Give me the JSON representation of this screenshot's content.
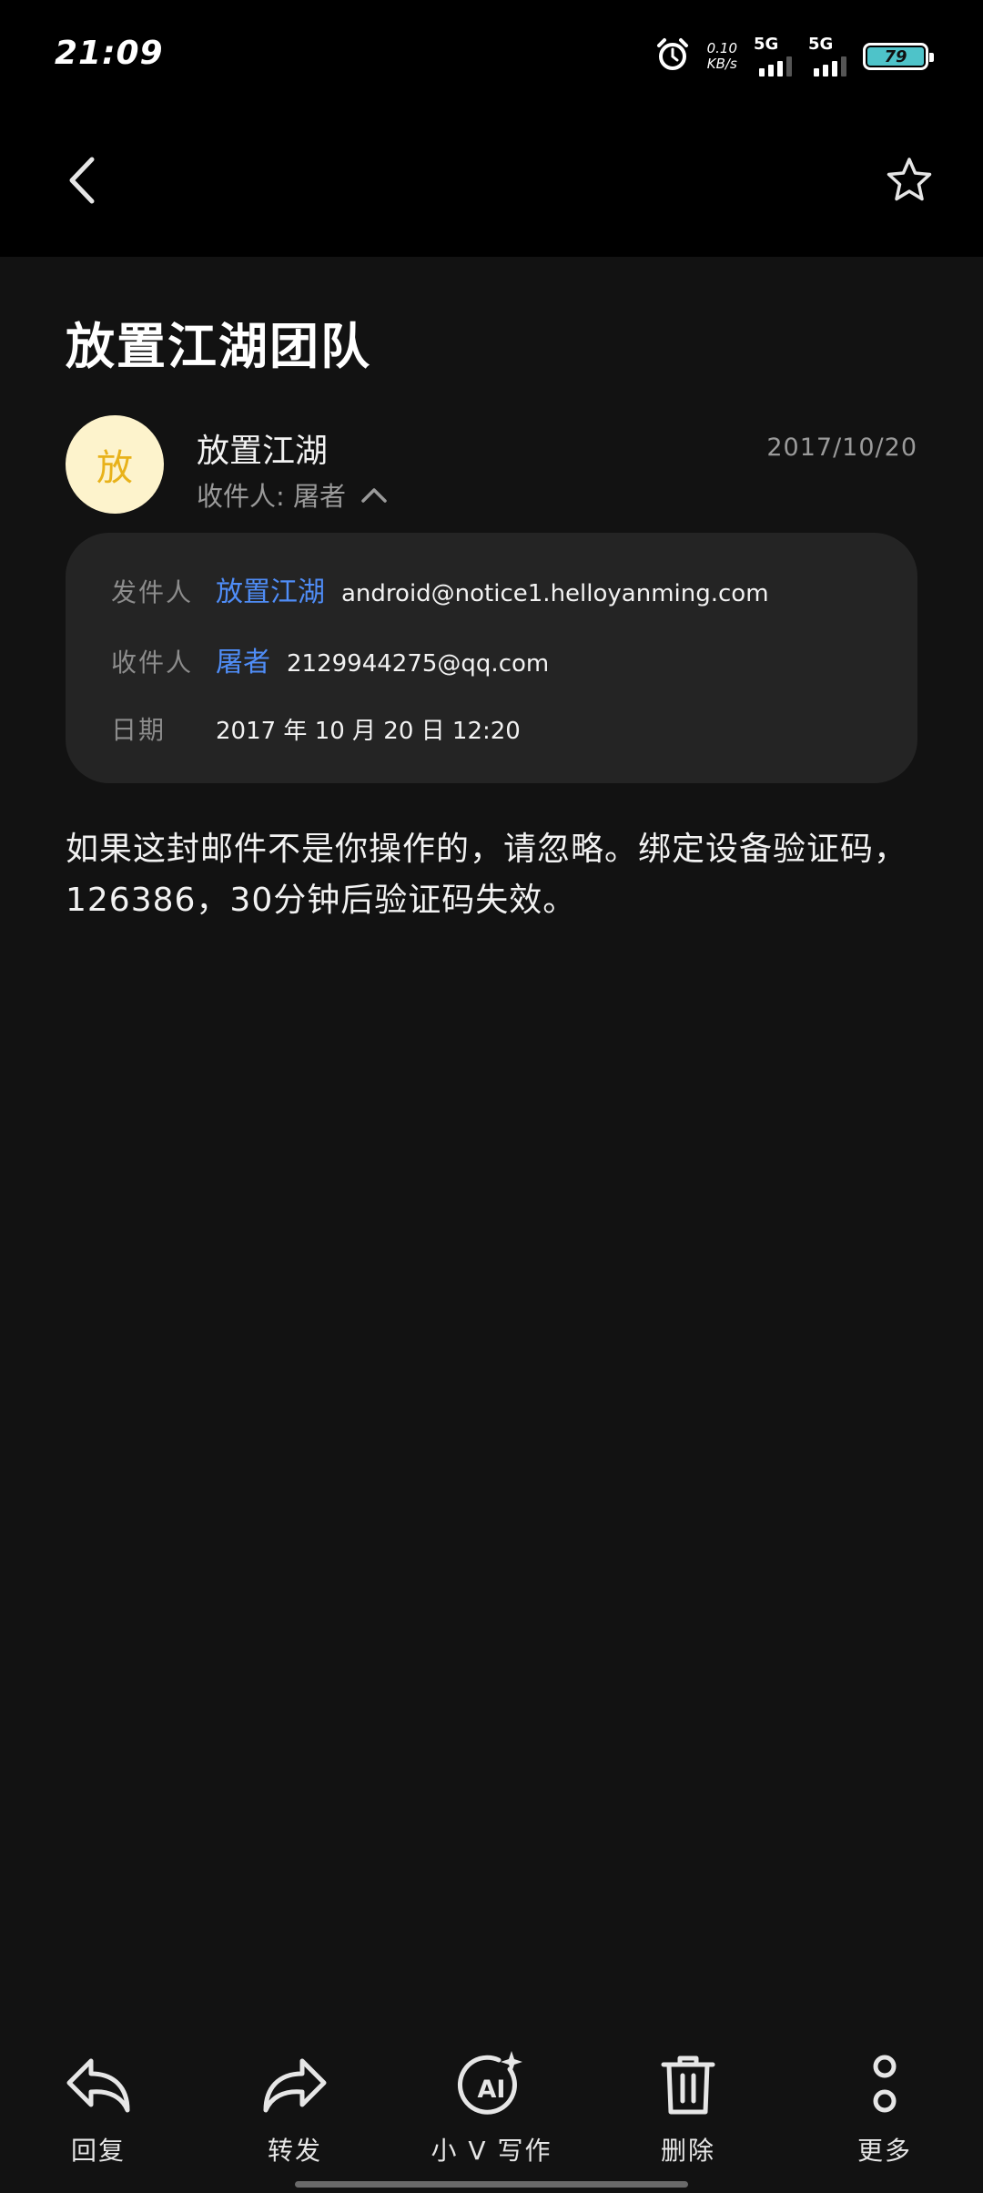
{
  "status_bar": {
    "time": "21:09",
    "net_speed_value": "0.10",
    "net_speed_unit": "KB/s",
    "sim1_label": "5G",
    "sim2_label": "5G",
    "battery_level": "79",
    "alarm_icon": "alarm-clock-icon"
  },
  "app_bar": {
    "back_icon": "chevron-left-icon",
    "favorite_icon": "star-outline-icon"
  },
  "email": {
    "subject": "放置江湖团队",
    "avatar_text": "放",
    "sender_name": "放置江湖",
    "date_short": "2017/10/20",
    "recipient_summary": "收件人: 屠者",
    "details": {
      "from_label": "发件人",
      "from_name": "放置江湖",
      "from_address": "android@notice1.helloyanming.com",
      "to_label": "收件人",
      "to_name": "屠者",
      "to_address": "2129944275@qq.com",
      "date_label": "日期",
      "date_full": "2017 年 10 月 20 日 12:20"
    },
    "body": "如果这封邮件不是你操作的，请忽略。绑定设备验证码，126386，30分钟后验证码失效。"
  },
  "toolbar": {
    "reply": "回复",
    "forward": "转发",
    "ai_write": "小 V 写作",
    "delete": "删除",
    "more": "更多"
  },
  "colors": {
    "background": "#121212",
    "top_bar": "#000000",
    "card": "#242424",
    "link_blue": "#4f8df7",
    "avatar_bg": "#fdf3cc",
    "avatar_text": "#e8b21a",
    "battery": "#4ec3c9"
  }
}
